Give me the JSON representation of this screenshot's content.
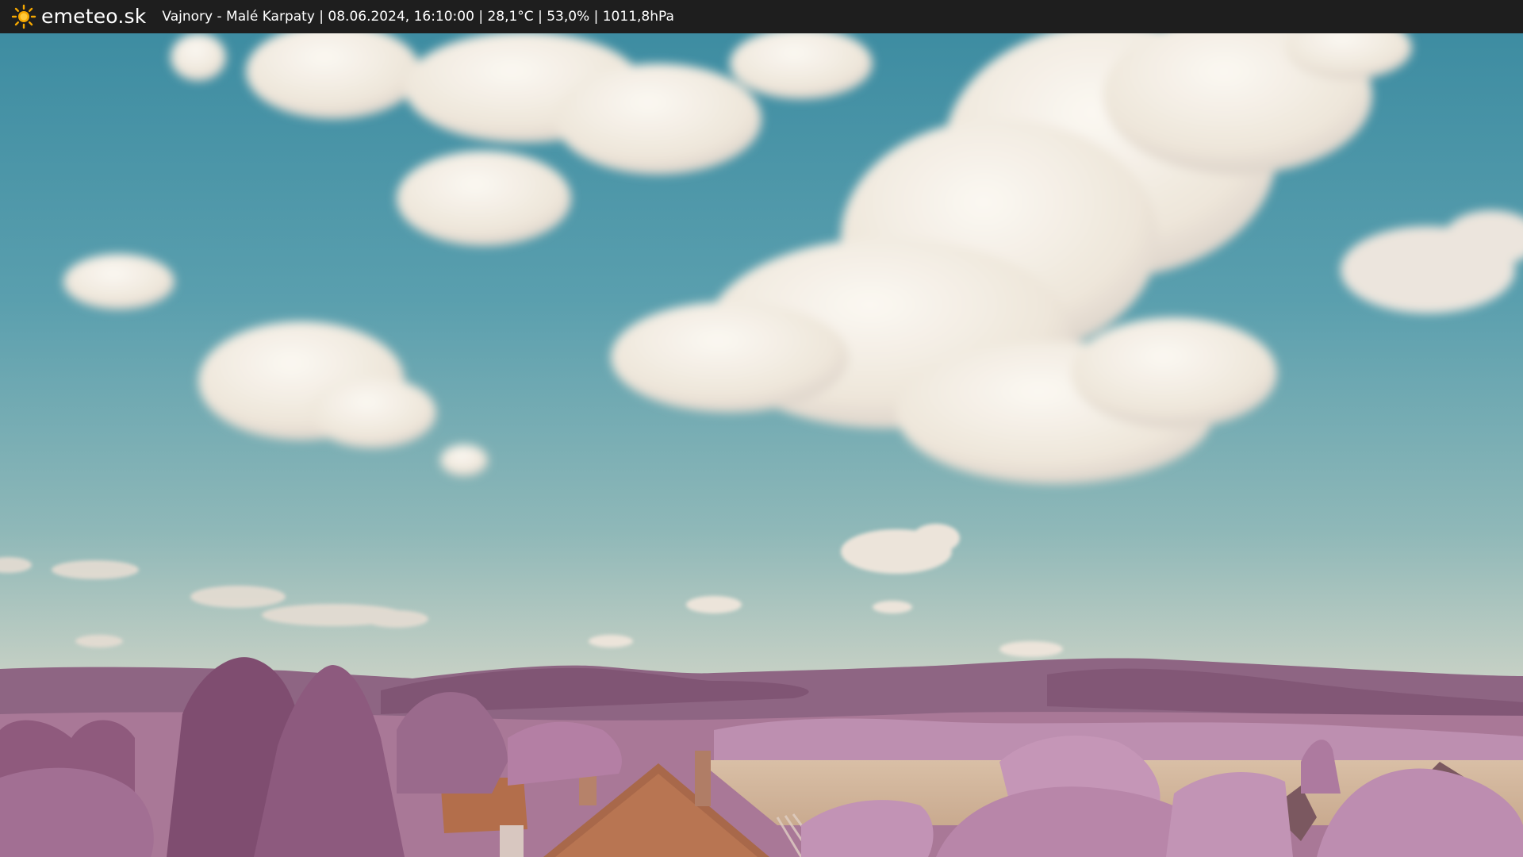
{
  "header": {
    "logo_icon": "sun-icon",
    "brand": "emeteo.sk",
    "station": "Vajnory - Malé Karpaty",
    "datetime": "08.06.2024, 16:10:00",
    "temperature": "28,1°C",
    "humidity": "53,0%",
    "pressure": "1011,8hPa",
    "info_line": "Vajnory - Malé Karpaty | 08.06.2024, 16:10:00 | 28,1°C | 53,0% | 1011,8hPa"
  },
  "colors": {
    "header_bg": "#1e1e1e",
    "sun": "#f6a800",
    "sky_top": "#3e8ea2",
    "sky_horizon": "#c9d3c6",
    "cloud": "#f4efe6",
    "hills": "#8a5c7e",
    "foliage": "#b784a8",
    "field": "#d3b79c",
    "roof": "#b8704c"
  }
}
